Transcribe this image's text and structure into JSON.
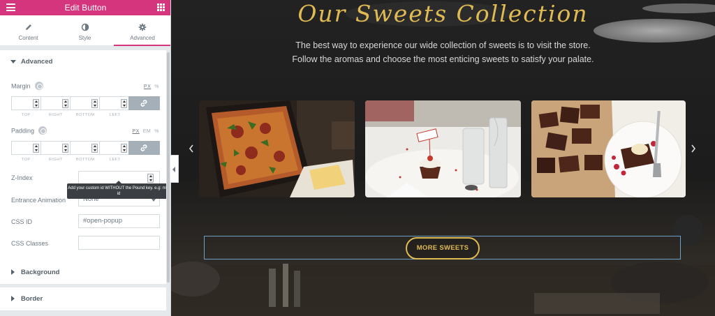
{
  "panel": {
    "title": "Edit Button",
    "tabs": [
      {
        "label": "Content",
        "icon": "pencil-icon"
      },
      {
        "label": "Style",
        "icon": "half-circle-icon"
      },
      {
        "label": "Advanced",
        "icon": "gear-icon"
      }
    ],
    "active_tab": "Advanced",
    "sections": {
      "advanced": "Advanced",
      "background": "Background",
      "border": "Border"
    },
    "margin": {
      "label": "Margin",
      "units": [
        "PX",
        "%"
      ],
      "active_unit": "PX",
      "sides": [
        "TOP",
        "RIGHT",
        "BOTTOM",
        "LEFT"
      ]
    },
    "padding": {
      "label": "Padding",
      "units": [
        "PX",
        "EM",
        "%"
      ],
      "active_unit": "PX",
      "sides": [
        "TOP",
        "RIGHT",
        "BOTTOM",
        "LEFT"
      ]
    },
    "z_index": {
      "label": "Z-Index",
      "value": ""
    },
    "entrance_animation": {
      "label": "Entrance Animation",
      "value": "None"
    },
    "css_id": {
      "label": "CSS ID",
      "value": "#open-popup"
    },
    "css_classes": {
      "label": "CSS Classes",
      "value": ""
    },
    "tooltip": "Add your custom id WITHOUT the Pound key. e.g: my-id"
  },
  "preview": {
    "heading": "Our Sweets Collection",
    "subtitle_line1": "The best way to experience our wide collection of sweets is to visit the store.",
    "subtitle_line2": "Follow the aromas and choose the most enticing sweets to satisfy your palate.",
    "cards": [
      {
        "image": "pizza-image"
      },
      {
        "image": "cupcake-table-image"
      },
      {
        "image": "brownies-image"
      }
    ],
    "button_label": "MORE SWEETS"
  },
  "colors": {
    "accent": "#d5357c",
    "gold": "#e0bb54",
    "panel_bg": "#e6e9ec"
  }
}
